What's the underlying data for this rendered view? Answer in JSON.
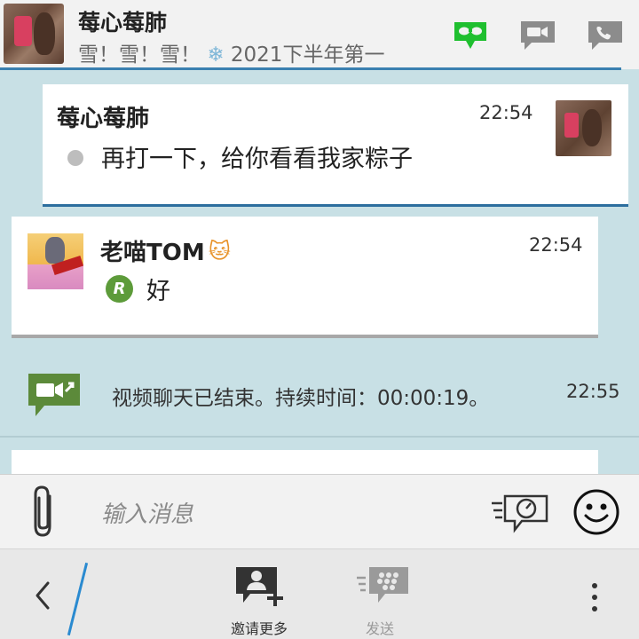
{
  "header": {
    "title": "莓心莓肺",
    "status_prefix": "雪！雪！雪！",
    "status_snow": "❄",
    "status_suffix": "2021下半年第一"
  },
  "messages": [
    {
      "sender": "莓心莓肺",
      "time": "22:54",
      "text": "再打一下，给你看看我家粽子"
    },
    {
      "sender": "老喵TOM",
      "sender_emoji": "🐱",
      "time": "22:54",
      "badge": "R",
      "text": "好"
    }
  ],
  "system_message": {
    "text": "视频聊天已结束。持续时间：00:00:19。",
    "time": "22:55"
  },
  "input": {
    "placeholder": "输入消息"
  },
  "nav": {
    "invite_label": "邀请更多",
    "send_label": "发送"
  },
  "colors": {
    "chat_bg": "#c8e0e5",
    "accent_blue": "#2c6e9e",
    "mask_green": "#1fbf2f",
    "read_badge": "#5d9b3a",
    "video_icon": "#5c8a3a"
  }
}
